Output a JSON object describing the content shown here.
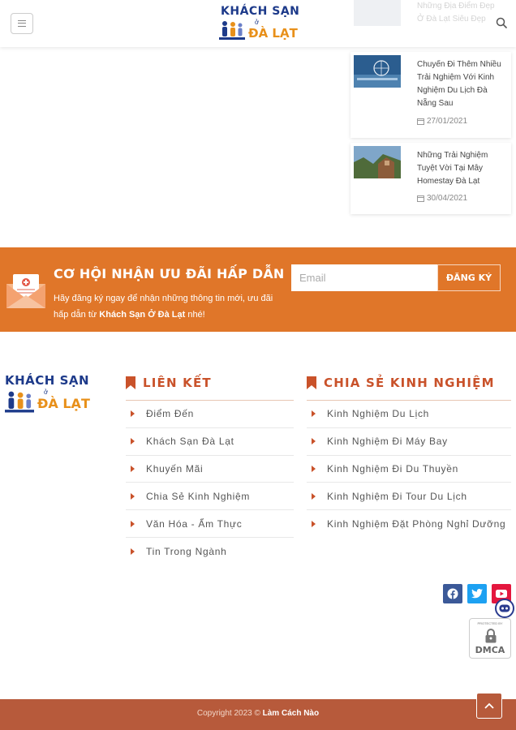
{
  "header": {
    "logo_line1": "KHÁCH SẠN",
    "logo_o": "ở",
    "logo_line2": "ĐÀ LẠT"
  },
  "ghost_post": {
    "title": "Những Địa Điểm Đẹp Ở Đà Lạt Siêu Đẹp"
  },
  "posts": [
    {
      "title": "Chuyến Đi Thêm Nhiều Trải Nghiệm Với Kinh Nghiệm Du Lịch Đà Nẵng Sau",
      "date": "27/01/2021"
    },
    {
      "title": "Những Trải Nghiệm Tuyệt Vời Tại Mây Homestay Đà Lạt",
      "date": "30/04/2021"
    }
  ],
  "newsletter": {
    "title": "CƠ HỘI NHẬN ƯU ĐÃI HẤP DẪN",
    "desc_prefix": "Hãy đăng ký ngay để nhận những thông tin mới, ưu đãi hấp dẫn từ ",
    "desc_brand": "Khách Sạn Ở Đà Lạt",
    "desc_suffix": " nhé!",
    "email_placeholder": "Email",
    "submit_label": "ĐĂNG KÝ"
  },
  "footer_logo": {
    "line1": "KHÁCH SẠN",
    "o": "ở",
    "line2": "ĐÀ LẠT"
  },
  "footer": {
    "links_col": {
      "title": "LIÊN KẾT",
      "items": [
        "Điểm Đến",
        "Khách Sạn Đà Lạt",
        "Khuyến Mãi",
        "Chia Sẻ Kinh Nghiệm",
        "Văn Hóa - Ẩm Thực",
        "Tin Trong Ngành"
      ]
    },
    "share_col": {
      "title": "CHIA SẺ KINH NGHIỆM",
      "items": [
        "Kinh Nghiệm Du Lịch",
        "Kinh Nghiệm Đi Máy Bay",
        "Kinh Nghiệm Đi Du Thuyền",
        "Kinh Nghiệm Đi Tour Du Lịch",
        "Kinh Nghiệm Đặt Phòng Nghỉ Dưỡng"
      ]
    }
  },
  "dmca": {
    "small_text": "PROTECTED BY",
    "word": "DMCA"
  },
  "bottom": {
    "copyright_prefix": "Copyright 2023 © ",
    "copyright_brand": "Làm Cách Nào"
  },
  "colors": {
    "accent_orange": "#e07629",
    "footer_brown": "#b75a3b",
    "heading_red": "#c9522a",
    "facebook": "#3b5998",
    "twitter": "#1da1f2",
    "youtube": "#e4173e"
  }
}
